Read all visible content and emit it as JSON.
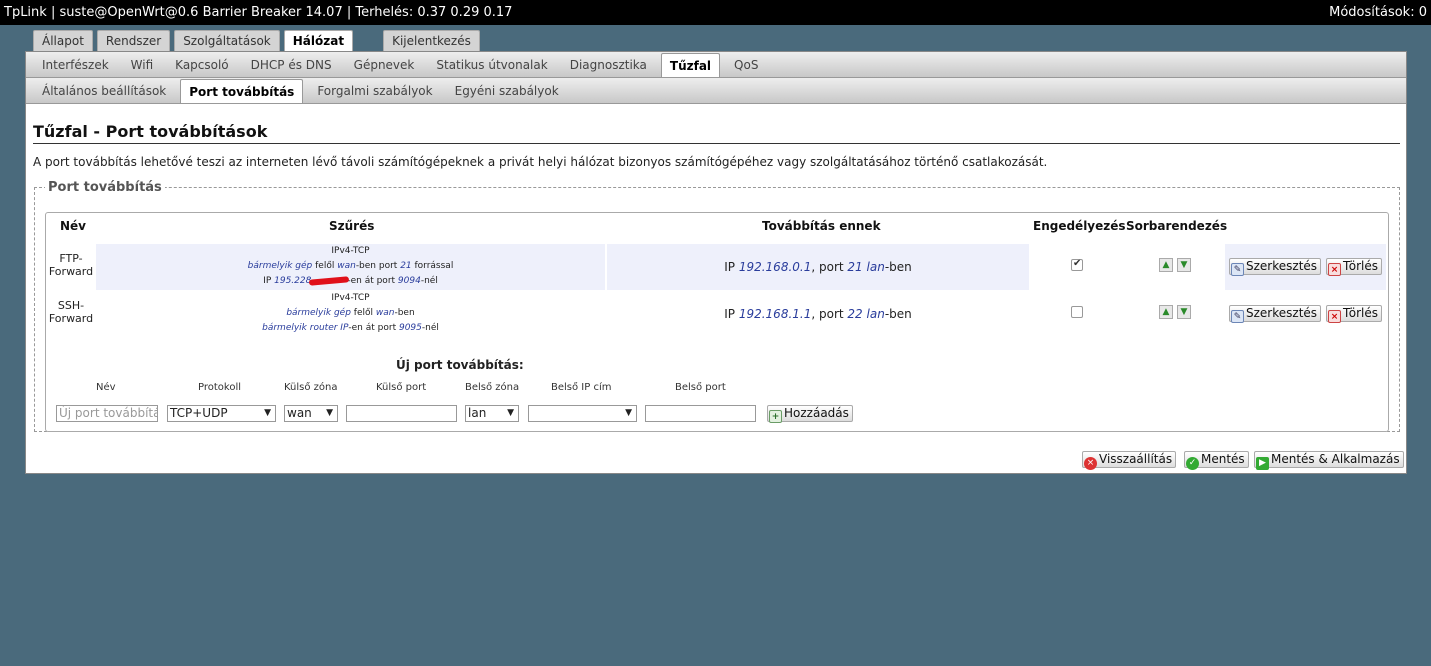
{
  "header": {
    "left": "TpLink | suste@OpenWrt@0.6 Barrier Breaker 14.07 | Terhelés: 0.37 0.29 0.17",
    "right": "Módosítások: 0"
  },
  "main_tabs": [
    "Állapot",
    "Rendszer",
    "Szolgáltatások",
    "Hálózat",
    "Kijelentkezés"
  ],
  "sub_tabs": [
    "Interfészek",
    "Wifi",
    "Kapcsoló",
    "DHCP és DNS",
    "Gépnevek",
    "Statikus útvonalak",
    "Diagnosztika",
    "Tűzfal",
    "QoS"
  ],
  "sub_tabs2": [
    "Általános beállítások",
    "Port továbbítás",
    "Forgalmi szabályok",
    "Egyéni szabályok"
  ],
  "page": {
    "title": "Tűzfal - Port továbbítások",
    "description": "A port továbbítás lehetővé teszi az interneten lévő távoli számítógépeknek a privát helyi hálózat bizonyos számítógépéhez vagy szolgáltatásához történő csatlakozását.",
    "section": "Port továbbítás"
  },
  "table": {
    "headers": {
      "name": "Név",
      "filter": "Szűrés",
      "forward": "Továbbítás ennek",
      "enable": "Engedélyezés",
      "order": "Sorbarendezés"
    },
    "rows": [
      {
        "name1": "FTP-",
        "name2": "Forward",
        "proto": "IPv4-TCP",
        "l2a": "bármelyik gép",
        "l2b": " felől ",
        "l2c": "wan",
        "l2d": "-ben port ",
        "l2e": "21",
        "l2f": " forrással",
        "l3a": "IP ",
        "l3b": "195.228",
        "l3c": "-en át port ",
        "l3d": "9094",
        "l3e": "-nél",
        "fwd_a": "IP ",
        "fwd_ip": "192.168.0.1",
        "fwd_b": ", port ",
        "fwd_port": "21",
        "fwd_zone": "lan",
        "fwd_c": "-ben",
        "enabled": true
      },
      {
        "name1": "SSH-",
        "name2": "Forward",
        "proto": "IPv4-TCP",
        "l2a": "bármelyik gép",
        "l2b": " felől ",
        "l2c": "wan",
        "l2d": "-ben",
        "l3a": "bármelyik router IP",
        "l3b": "-en át port ",
        "l3c": "9095",
        "l3d": "-nél",
        "fwd_a": "IP ",
        "fwd_ip": "192.168.1.1",
        "fwd_b": ", port ",
        "fwd_port": "22",
        "fwd_zone": "lan",
        "fwd_c": "-ben",
        "enabled": false
      }
    ],
    "edit_label": "Szerkesztés",
    "delete_label": "Törlés"
  },
  "new_rule": {
    "title": "Új port továbbítás:",
    "cols": [
      "Név",
      "Protokoll",
      "Külső zóna",
      "Külső port",
      "Belső zóna",
      "Belső IP cím",
      "Belső port"
    ],
    "name_placeholder": "Új port továbbítás",
    "protocol": "TCP+UDP",
    "ext_zone": "wan",
    "int_zone": "lan",
    "add_label": "Hozzáadás"
  },
  "footer": {
    "reset": "Visszaállítás",
    "save": "Mentés",
    "apply": "Mentés & Alkalmazás"
  }
}
